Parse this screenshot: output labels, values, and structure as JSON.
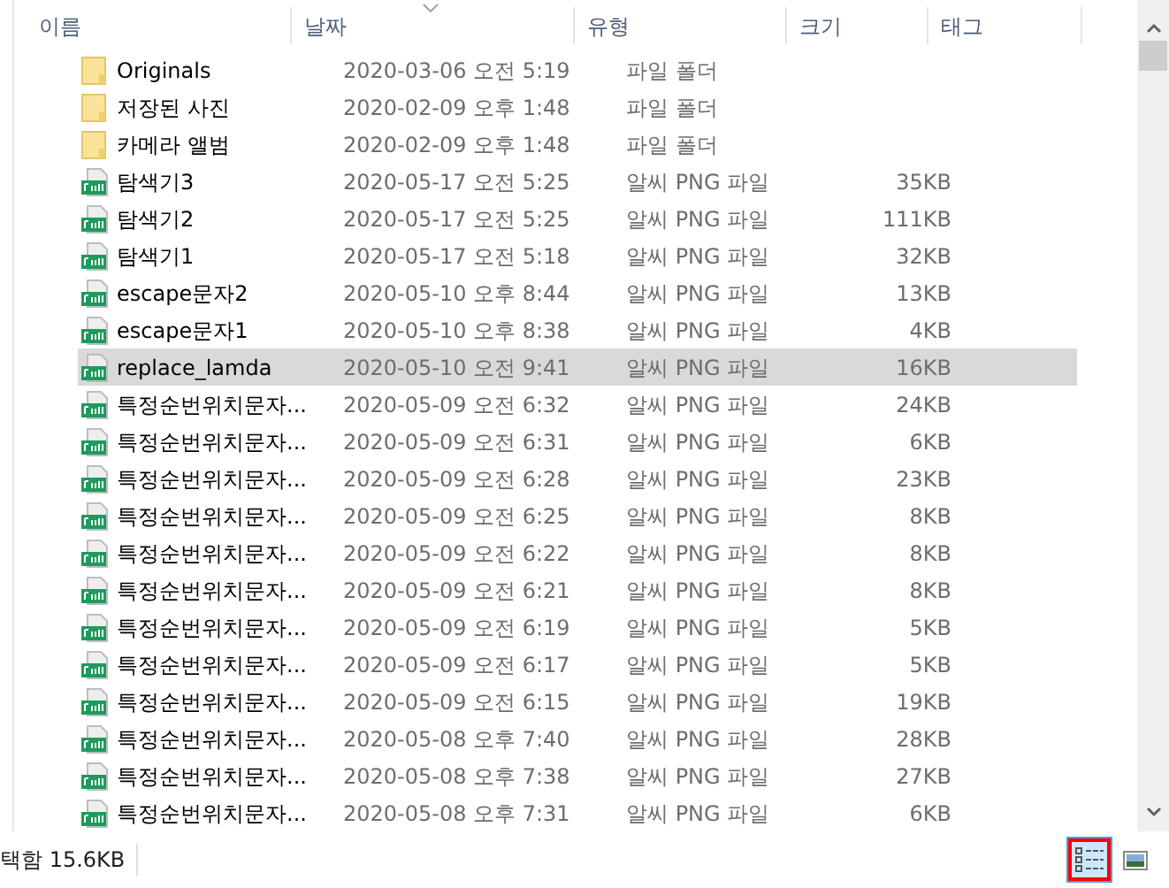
{
  "columns": [
    {
      "label": "이름"
    },
    {
      "label": "날짜",
      "sorted": true
    },
    {
      "label": "유형"
    },
    {
      "label": "크기"
    },
    {
      "label": "태그"
    }
  ],
  "rows": [
    {
      "kind": "folder",
      "name": "Originals",
      "date": "2020-03-06 오전 5:19",
      "type": "파일 폴더",
      "selected": false
    },
    {
      "kind": "folder",
      "name": "저장된 사진",
      "date": "2020-02-09 오후 1:48",
      "type": "파일 폴더",
      "selected": false
    },
    {
      "kind": "folder",
      "name": "카메라 앨범",
      "date": "2020-02-09 오후 1:48",
      "type": "파일 폴더",
      "selected": false
    },
    {
      "kind": "png",
      "name": "탐색기3",
      "date": "2020-05-17 오전 5:25",
      "type": "알씨 PNG 파일",
      "size": "35KB",
      "selected": false
    },
    {
      "kind": "png",
      "name": "탐색기2",
      "date": "2020-05-17 오전 5:25",
      "type": "알씨 PNG 파일",
      "size": "111KB",
      "selected": false
    },
    {
      "kind": "png",
      "name": "탐색기1",
      "date": "2020-05-17 오전 5:18",
      "type": "알씨 PNG 파일",
      "size": "32KB",
      "selected": false
    },
    {
      "kind": "png",
      "name": "escape문자2",
      "date": "2020-05-10 오후 8:44",
      "type": "알씨 PNG 파일",
      "size": "13KB",
      "selected": false
    },
    {
      "kind": "png",
      "name": "escape문자1",
      "date": "2020-05-10 오후 8:38",
      "type": "알씨 PNG 파일",
      "size": "4KB",
      "selected": false
    },
    {
      "kind": "png",
      "name": "replace_lamda",
      "date": "2020-05-10 오전 9:41",
      "type": "알씨 PNG 파일",
      "size": "16KB",
      "selected": true
    },
    {
      "kind": "png",
      "name": "특정순번위치문자...",
      "date": "2020-05-09 오전 6:32",
      "type": "알씨 PNG 파일",
      "size": "24KB",
      "selected": false
    },
    {
      "kind": "png",
      "name": "특정순번위치문자...",
      "date": "2020-05-09 오전 6:31",
      "type": "알씨 PNG 파일",
      "size": "6KB",
      "selected": false
    },
    {
      "kind": "png",
      "name": "특정순번위치문자...",
      "date": "2020-05-09 오전 6:28",
      "type": "알씨 PNG 파일",
      "size": "23KB",
      "selected": false
    },
    {
      "kind": "png",
      "name": "특정순번위치문자...",
      "date": "2020-05-09 오전 6:25",
      "type": "알씨 PNG 파일",
      "size": "8KB",
      "selected": false
    },
    {
      "kind": "png",
      "name": "특정순번위치문자...",
      "date": "2020-05-09 오전 6:22",
      "type": "알씨 PNG 파일",
      "size": "8KB",
      "selected": false
    },
    {
      "kind": "png",
      "name": "특정순번위치문자...",
      "date": "2020-05-09 오전 6:21",
      "type": "알씨 PNG 파일",
      "size": "8KB",
      "selected": false
    },
    {
      "kind": "png",
      "name": "특정순번위치문자...",
      "date": "2020-05-09 오전 6:19",
      "type": "알씨 PNG 파일",
      "size": "5KB",
      "selected": false
    },
    {
      "kind": "png",
      "name": "특정순번위치문자...",
      "date": "2020-05-09 오전 6:17",
      "type": "알씨 PNG 파일",
      "size": "5KB",
      "selected": false
    },
    {
      "kind": "png",
      "name": "특정순번위치문자...",
      "date": "2020-05-09 오전 6:15",
      "type": "알씨 PNG 파일",
      "size": "19KB",
      "selected": false
    },
    {
      "kind": "png",
      "name": "특정순번위치문자...",
      "date": "2020-05-08 오후 7:40",
      "type": "알씨 PNG 파일",
      "size": "28KB",
      "selected": false
    },
    {
      "kind": "png",
      "name": "특정순번위치문자...",
      "date": "2020-05-08 오후 7:38",
      "type": "알씨 PNG 파일",
      "size": "27KB",
      "selected": false
    },
    {
      "kind": "png",
      "name": "특정순번위치문자...",
      "date": "2020-05-08 오후 7:31",
      "type": "알씨 PNG 파일",
      "size": "6KB",
      "selected": false
    }
  ],
  "status_bar": {
    "text": "택함 15.6KB",
    "view_buttons": [
      {
        "kind": "details",
        "selected": true
      },
      {
        "kind": "thumbnails",
        "selected": false
      }
    ]
  }
}
